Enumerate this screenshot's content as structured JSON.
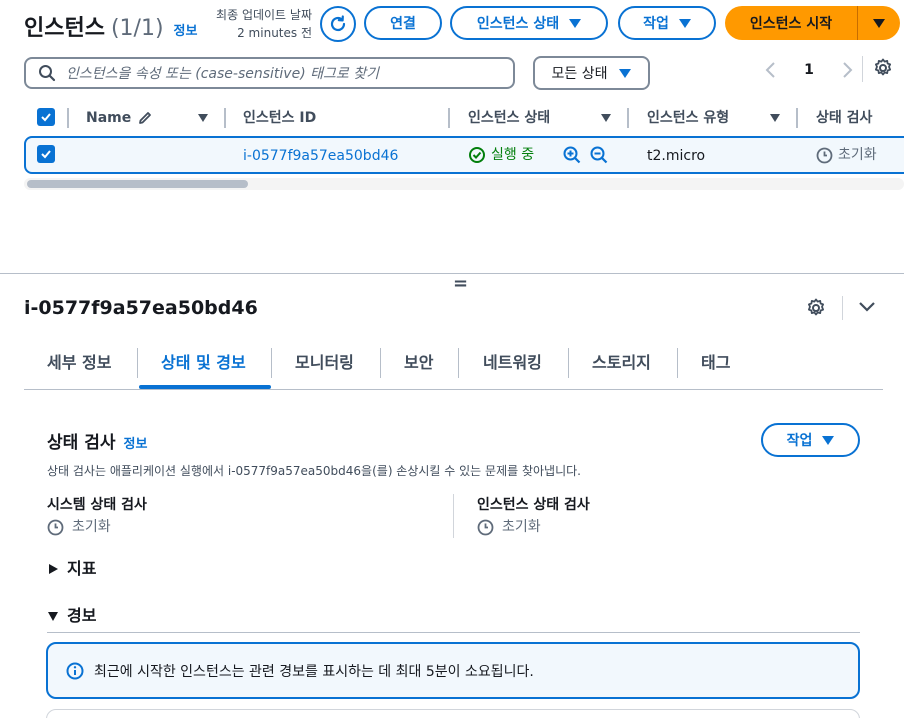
{
  "header": {
    "title": "인스턴스",
    "count": "(1/1)",
    "info_link": "정보",
    "last_updated_label": "최종 업데이트 날짜",
    "last_updated_value": "2 minutes 전",
    "connect_label": "연결",
    "instance_state_label": "인스턴스 상태",
    "actions_label": "작업",
    "launch_label": "인스턴스 시작"
  },
  "filter": {
    "search_placeholder": "인스턴스을 속성 또는 (case-sensitive) 태그로 찾기",
    "state_filter_label": "모든 상태",
    "page": "1"
  },
  "table": {
    "columns": [
      "Name",
      "인스턴스 ID",
      "인스턴스 상태",
      "인스턴스 유형",
      "상태 검사"
    ],
    "rows": [
      {
        "name": "",
        "instance_id": "i-0577f9a57ea50bd46",
        "state": "실행 중",
        "type": "t2.micro",
        "status_check": "초기화"
      }
    ]
  },
  "splitter": "=",
  "detail": {
    "instance_id": "i-0577f9a57ea50bd46",
    "tabs": [
      "세부 정보",
      "상태 및 경보",
      "모니터링",
      "보안",
      "네트워킹",
      "스토리지",
      "태그"
    ],
    "active_tab": "상태 및 경보",
    "section_title": "상태 검사",
    "section_info": "정보",
    "actions_label": "작업",
    "description": "상태 검사는 애플리케이션 실행에서 i-0577f9a57ea50bd46을(를) 손상시킬 수 있는 문제를 찾아냅니다.",
    "system_check_label": "시스템 상태 검사",
    "system_check_value": "초기화",
    "instance_check_label": "인스턴스 상태 검사",
    "instance_check_value": "초기화",
    "metrics_label": "지표",
    "alarms_label": "경보",
    "alarm_notice": "최근에 시작한 인스턴스는 관련 경보를 표시하는 데 최대 5분이 소요됩니다."
  },
  "colors": {
    "accent": "#0972d3",
    "primary_button": "#ff9900",
    "success": "#037f0c",
    "info_bg": "#f2f8fd"
  }
}
